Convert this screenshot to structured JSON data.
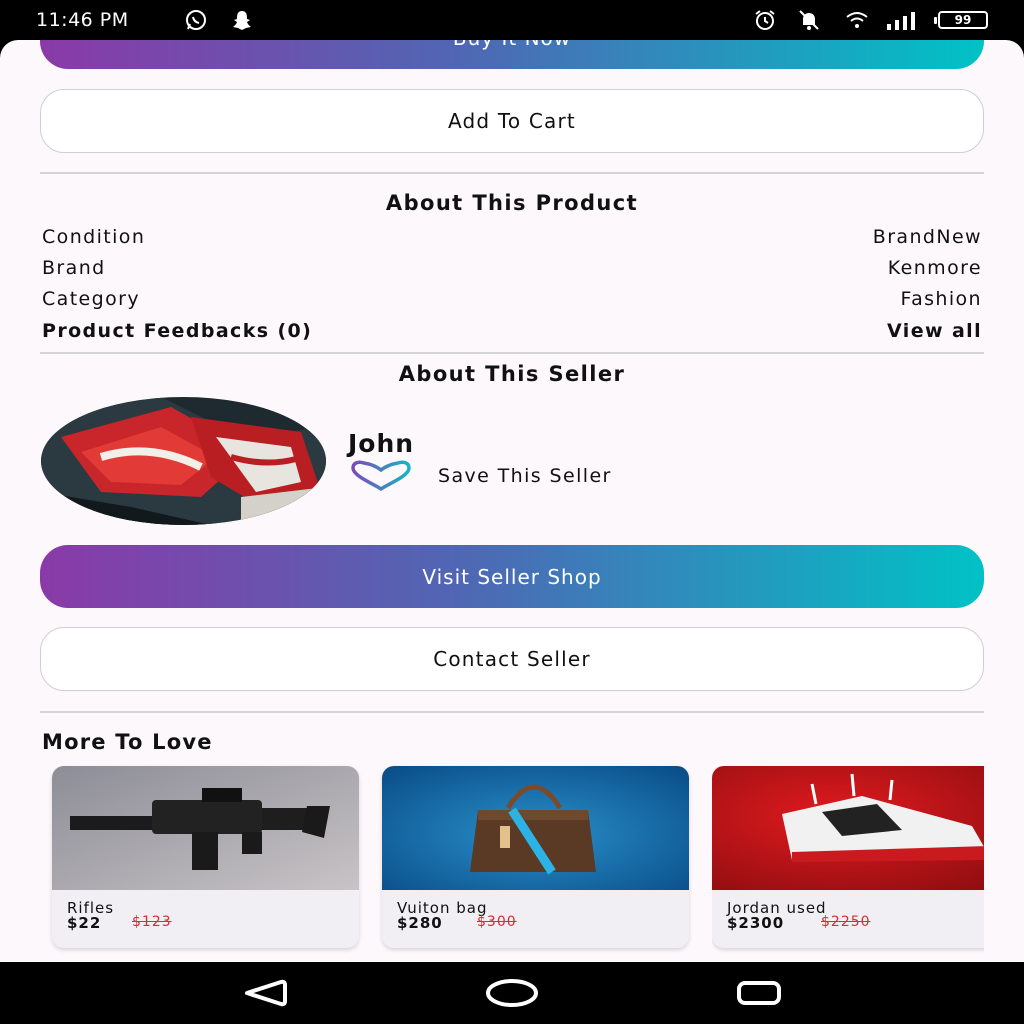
{
  "status_bar": {
    "time": "11:46 PM",
    "battery": "99",
    "icons": [
      "whatsapp-icon",
      "snapchat-icon",
      "alarm-icon",
      "notifications-off-icon",
      "wifi-icon",
      "signal-icon"
    ]
  },
  "buttons": {
    "buy_now": "Buy It Now",
    "add_to_cart": "Add To Cart",
    "visit_shop": "Visit Seller Shop",
    "contact_seller": "Contact Seller"
  },
  "about_product": {
    "title": "About This Product",
    "rows": [
      {
        "label": "Condition",
        "value": "BrandNew"
      },
      {
        "label": "Brand",
        "value": "Kenmore"
      },
      {
        "label": "Category",
        "value": "Fashion"
      }
    ],
    "feedbacks_label": "Product Feedbacks (0)",
    "view_all": "View all"
  },
  "about_seller": {
    "title": "About This Seller",
    "name": "John",
    "save_label": "Save This Seller"
  },
  "more_to_love": {
    "title": "More To Love",
    "items": [
      {
        "name": "Rifles",
        "price": "$22",
        "old_price": "$123"
      },
      {
        "name": "Vuiton bag",
        "price": "$280",
        "old_price": "$300"
      },
      {
        "name": "Jordan used",
        "price": "$2300",
        "old_price": "$2250"
      }
    ]
  },
  "colors": {
    "gradient_start": "#8a3aa8",
    "gradient_end": "#00c2c6",
    "strike_price": "#d4302c"
  }
}
